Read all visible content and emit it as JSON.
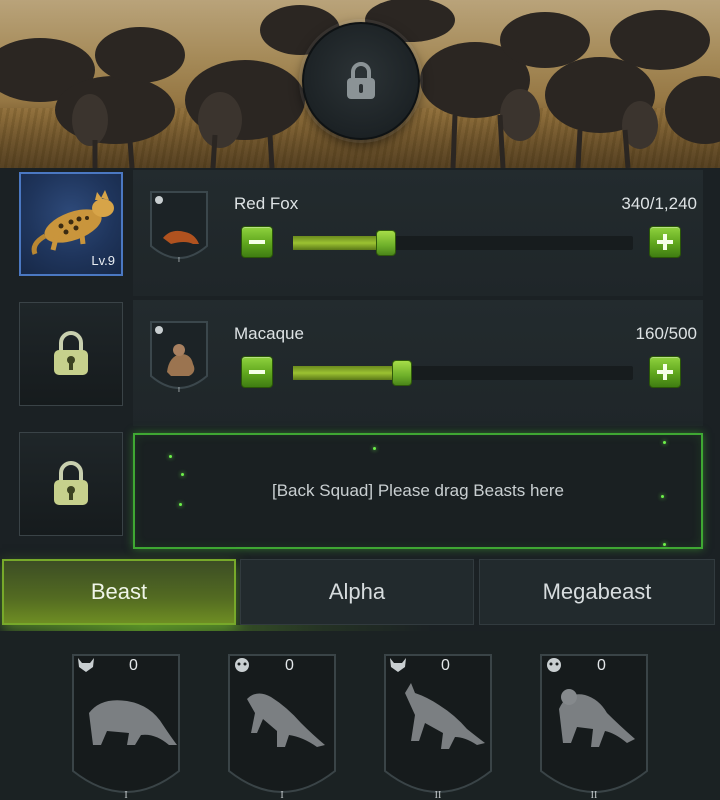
{
  "banner": {
    "lock_icon": "padlock-icon"
  },
  "squad": [
    {
      "portrait": {
        "type": "beast",
        "level": "Lv.9",
        "icon": "ocelot-portrait"
      },
      "name": "Red Fox",
      "count": "340/1,240",
      "slider_fraction": 0.274,
      "rank": "I"
    },
    {
      "portrait": {
        "type": "locked",
        "icon": "padlock-icon"
      },
      "name": "Macaque",
      "count": "160/500",
      "slider_fraction": 0.32,
      "rank": "I"
    }
  ],
  "back_squad": {
    "portrait_icon": "padlock-icon",
    "text": "[Back Squad] Please drag Beasts here"
  },
  "tabs": [
    {
      "label": "Beast",
      "active": true
    },
    {
      "label": "Alpha",
      "active": false
    },
    {
      "label": "Megabeast",
      "active": false
    }
  ],
  "beast_cards": [
    {
      "icon": "wolf-icon",
      "count": "0",
      "rank": "I",
      "animal": "badger"
    },
    {
      "icon": "ape-icon",
      "count": "0",
      "rank": "I",
      "animal": "mongoose"
    },
    {
      "icon": "wolf-icon",
      "count": "0",
      "rank": "II",
      "animal": "jackal"
    },
    {
      "icon": "ape-icon",
      "count": "0",
      "rank": "II",
      "animal": "monkey"
    }
  ],
  "colors": {
    "accent_green": "#6fb02a",
    "active_portrait_blue": "#1f355c",
    "panel": "#232b2e",
    "background": "#1b2124"
  }
}
